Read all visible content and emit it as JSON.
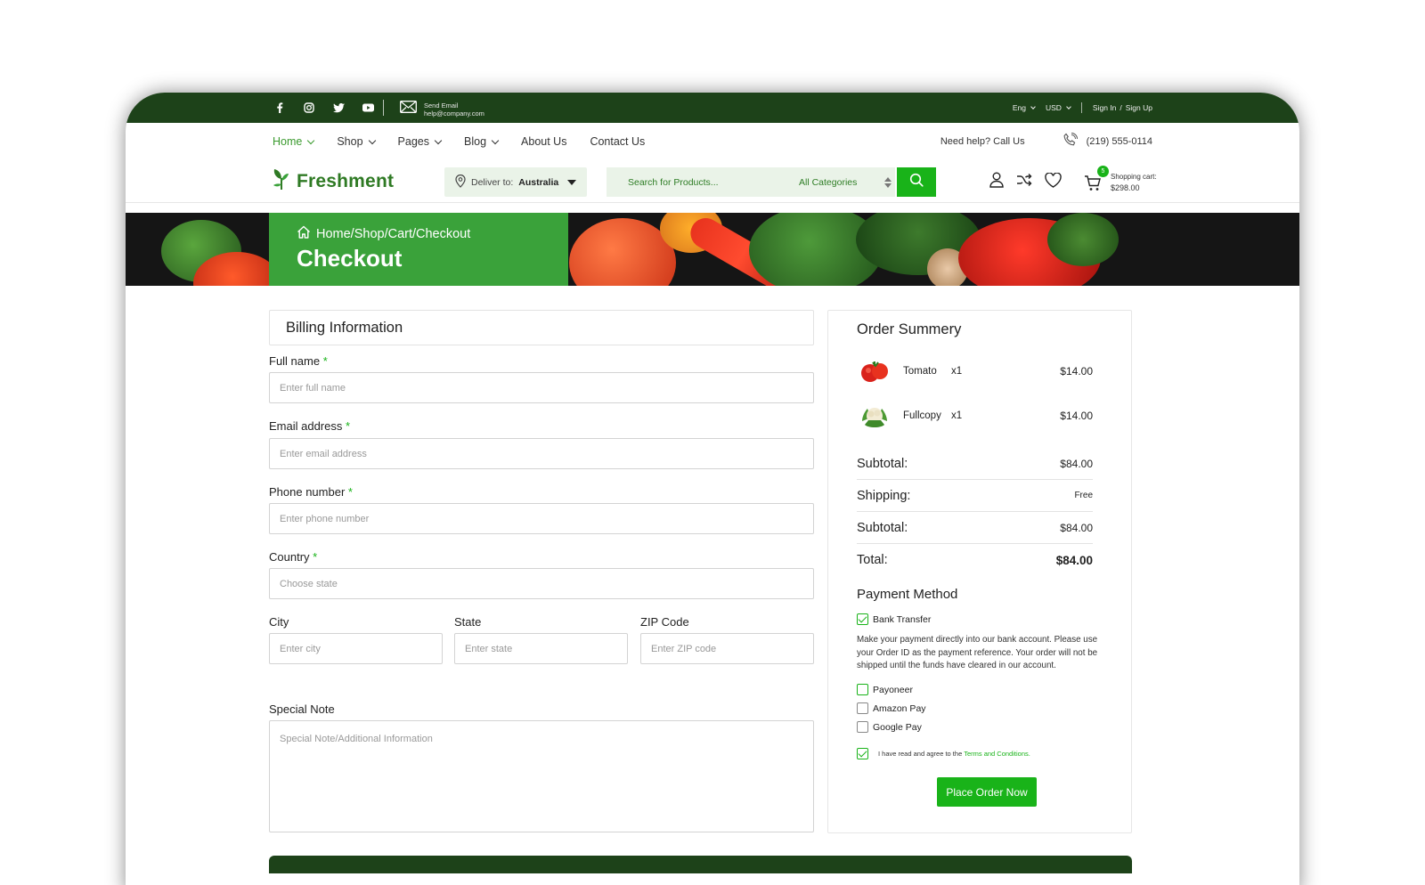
{
  "topbar": {
    "mail_title": "Send Email",
    "mail_address": "help@company.com",
    "language": "Eng",
    "currency": "USD",
    "sign_in": "Sign In",
    "slash": "/",
    "sign_up": "Sign Up"
  },
  "nav": {
    "items": [
      {
        "label": "Home",
        "dropdown": true,
        "active": true
      },
      {
        "label": "Shop",
        "dropdown": true
      },
      {
        "label": "Pages",
        "dropdown": true
      },
      {
        "label": "Blog",
        "dropdown": true
      },
      {
        "label": "About Us",
        "dropdown": false
      },
      {
        "label": "Contact Us",
        "dropdown": false
      }
    ],
    "help_text": "Need help? Call Us",
    "phone": "(219) 555-0114"
  },
  "header": {
    "brand": "Freshment",
    "deliver_label": "Deliver to:",
    "deliver_value": "Australia",
    "search_placeholder": "Search for Products...",
    "category": "All Categories",
    "cart_count": "5",
    "cart_label": "Shopping cart:",
    "cart_total": "$298.00"
  },
  "banner": {
    "breadcrumb": "Home/Shop/Cart/Checkout",
    "title": "Checkout"
  },
  "billing": {
    "title": "Billing Information",
    "required_mark": "*",
    "full_name_label": "Full name",
    "full_name_placeholder": "Enter full name",
    "email_label": "Email address",
    "email_placeholder": "Enter email address",
    "phone_label": "Phone number",
    "phone_placeholder": "Enter phone number",
    "country_label": "Country",
    "country_placeholder": "Choose state",
    "city_label": "City",
    "city_placeholder": "Enter city",
    "state_label": "State",
    "state_placeholder": "Enter state",
    "zip_label": "ZIP Code",
    "zip_placeholder": "Enter ZIP code",
    "note_label": "Special Note",
    "note_placeholder": "Special Note/Additional Information"
  },
  "summary": {
    "title": "Order Summery",
    "items": [
      {
        "name": "Tomato",
        "qty": "x1",
        "price": "$14.00"
      },
      {
        "name": "Fullcopy",
        "qty": "x1",
        "price": "$14.00"
      }
    ],
    "rows": [
      {
        "label": "Subtotal:",
        "value": "$84.00"
      },
      {
        "label": "Shipping:",
        "value": "Free"
      },
      {
        "label": "Subtotal:",
        "value": "$84.00"
      },
      {
        "label": "Total:",
        "value": "$84.00"
      }
    ],
    "payment_title": "Payment Method",
    "bank_transfer": "Bank Transfer",
    "bank_desc": "Make your payment directly into our bank account. Please use your Order ID as the payment reference. Your order will not be shipped until the funds have cleared in our account.",
    "payoneer": "Payoneer",
    "amazon_pay": "Amazon Pay",
    "google_pay": "Google Pay",
    "agree_text": "I have read and agree to the",
    "terms_link": "Terms and Conditions.",
    "place_order": "Place Order Now"
  },
  "colors": {
    "dark_green": "#1d4219",
    "brand_green": "#19b319",
    "banner_green": "#3aa23a"
  }
}
